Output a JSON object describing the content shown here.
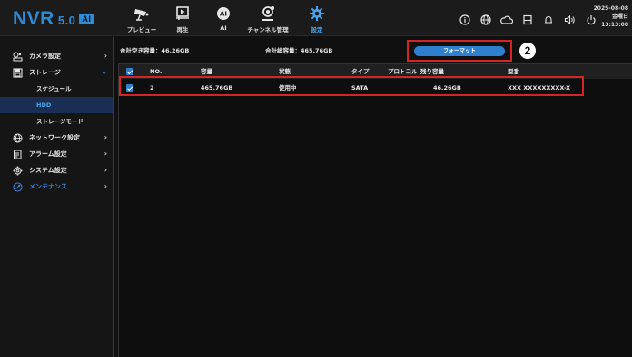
{
  "brand": {
    "name": "NVR",
    "version": "5.0",
    "badge": "AI"
  },
  "nav": [
    {
      "label": "プレビュー",
      "icon": "camera-icon"
    },
    {
      "label": "再生",
      "icon": "playback-icon"
    },
    {
      "label": "AI",
      "icon": "ai-icon"
    },
    {
      "label": "チャンネル管理",
      "icon": "channel-icon"
    },
    {
      "label": "設定",
      "icon": "settings-gear-icon",
      "active": true
    }
  ],
  "system_icons": [
    "info-icon",
    "network-globe-icon",
    "cloud-icon",
    "storage-icon",
    "bell-icon",
    "speaker-icon",
    "power-icon"
  ],
  "clock": {
    "date": "2025-08-08",
    "weekday": "金曜日",
    "time": "13:13:08"
  },
  "sidebar": {
    "items": [
      {
        "label": "カメラ設定",
        "icon": "camera-settings-icon",
        "arrow": "›"
      },
      {
        "label": "ストレージ",
        "icon": "storage-icon",
        "arrow": "⌄",
        "children": [
          "スケジュール",
          "HDD",
          "ストレージモード"
        ]
      },
      {
        "label": "ネットワーク設定",
        "icon": "network-icon",
        "arrow": "›"
      },
      {
        "label": "アラーム設定",
        "icon": "alarm-icon",
        "arrow": "›"
      },
      {
        "label": "システム設定",
        "icon": "system-icon",
        "arrow": "›"
      },
      {
        "label": "メンテナンス",
        "icon": "maintenance-icon",
        "arrow": "›"
      }
    ],
    "active_child": "HDD"
  },
  "summary": {
    "free": "合計空き容量：46.26GB",
    "total": "合計総容量：465.76GB"
  },
  "format_button": "フォーマット",
  "callout": "2",
  "table": {
    "columns": [
      "NO.",
      "容量",
      "状態",
      "タイプ",
      "プロトコル",
      "残り容量",
      "型番"
    ],
    "rows": [
      {
        "no": "2",
        "capacity": "465.76GB",
        "status": "使用中",
        "type": "SATA",
        "protocol": "",
        "remaining": "46.26GB",
        "model": "XXX XXXXXXXXX-X",
        "checked": true
      }
    ]
  },
  "colors": {
    "accent": "#2f7fcf",
    "highlight": "#d32525",
    "background": "#101010"
  }
}
